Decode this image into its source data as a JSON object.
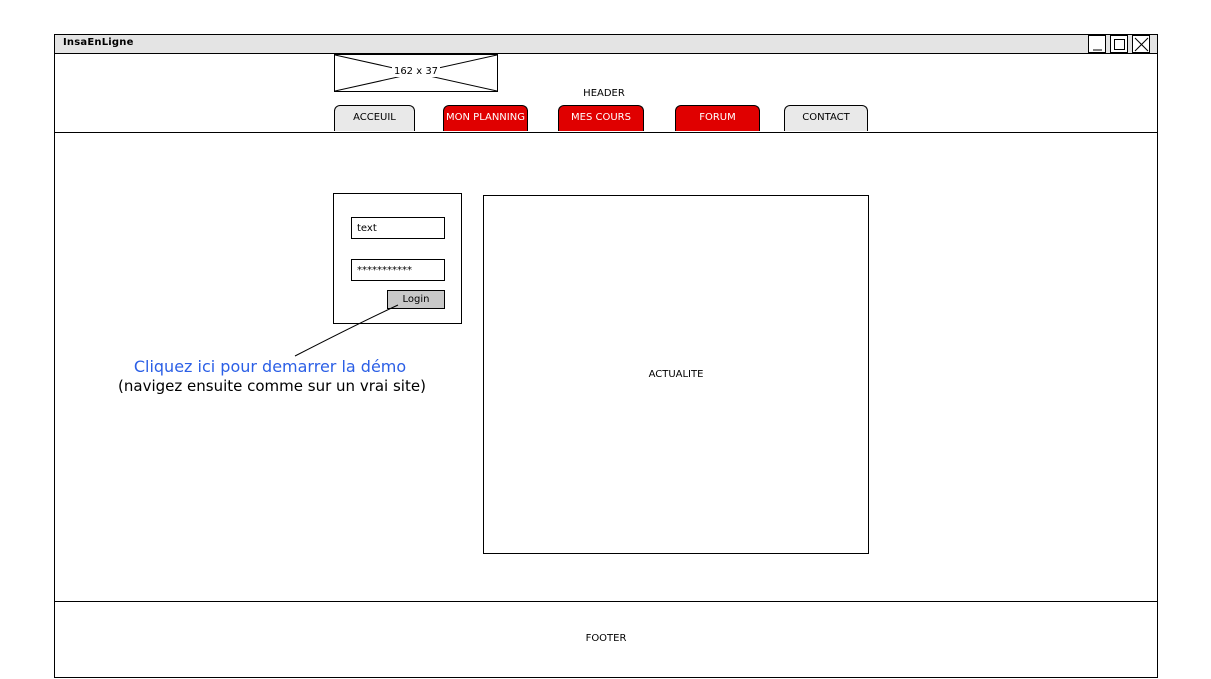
{
  "window": {
    "title": "InsaEnLigne",
    "controls": [
      "minimize-icon",
      "maximize-icon",
      "close-icon"
    ]
  },
  "header": {
    "logo_placeholder": "162 x 37",
    "label": "HEADER",
    "tabs": [
      {
        "label": "ACCEUIL",
        "active": false
      },
      {
        "label": "MON PLANNING",
        "active": true
      },
      {
        "label": "MES COURS",
        "active": true
      },
      {
        "label": "FORUM",
        "active": true
      },
      {
        "label": "CONTACT",
        "active": false
      }
    ]
  },
  "login": {
    "username_value": "text",
    "password_value": "***********",
    "button_label": "Login"
  },
  "annotation": {
    "line1": "Cliquez ici pour demarrer la démo",
    "line2": "(navigez ensuite comme sur un vrai site)"
  },
  "news": {
    "label": "ACTUALITE"
  },
  "footer": {
    "label": "FOOTER"
  },
  "colors": {
    "active_tab": "#e00000",
    "inactive_tab": "#e9e9e9",
    "annotation_blue": "#2b5fe6",
    "titlebar": "#e4e4e4"
  }
}
